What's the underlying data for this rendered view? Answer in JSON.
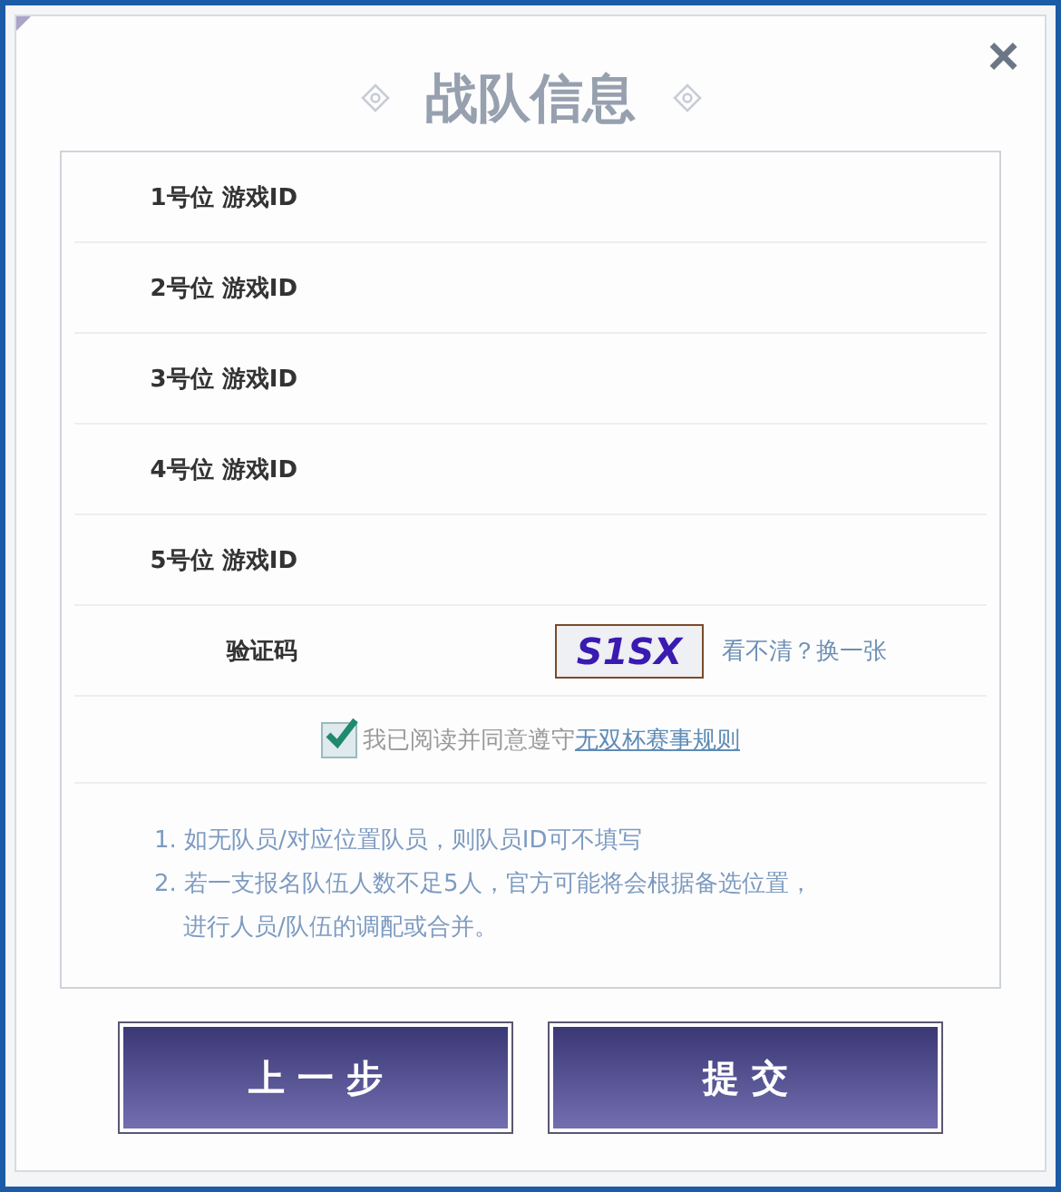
{
  "dialog": {
    "title": "战队信息",
    "close": "×"
  },
  "players": [
    {
      "label": "1号位 游戏ID"
    },
    {
      "label": "2号位 游戏ID"
    },
    {
      "label": "3号位 游戏ID"
    },
    {
      "label": "4号位 游戏ID"
    },
    {
      "label": "5号位 游戏ID"
    }
  ],
  "captcha": {
    "label": "验证码",
    "code": "S1SX",
    "refresh": "看不清？换一张"
  },
  "agreement": {
    "checked": true,
    "text": "我已阅读并同意遵守",
    "link": "无双杯赛事规则"
  },
  "notes": [
    "1. 如无队员/对应位置队员，则队员ID可不填写",
    "2. 若一支报名队伍人数不足5人，官方可能将会根据备选位置，",
    "进行人员/队伍的调配或合并。"
  ],
  "buttons": [
    {
      "label": "上 一 步"
    },
    {
      "label": "提 交"
    }
  ]
}
